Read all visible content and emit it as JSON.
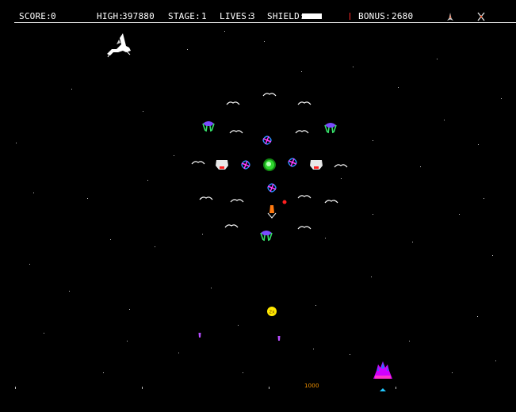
{
  "hud": {
    "score_label": "SCORE:",
    "score_value": "0",
    "high_label": "HIGH:",
    "high_value": "397880",
    "stage_label": "STAGE:",
    "stage_value": "1",
    "lives_label": "LIVES:",
    "lives_value": "3",
    "shield_label": "SHIELD:",
    "shield_level": 1.0,
    "bonus_label": "BONUS:",
    "bonus_value": "2680",
    "reserve_icons": [
      "reserve-ship-icon",
      "crossed-weapon-icon"
    ]
  },
  "popup": {
    "points": "1000"
  },
  "powerup": {
    "label": "2x"
  },
  "colors": {
    "background": "#000000",
    "hud_text": "#ffffff",
    "player_ship": "#d000ff",
    "enemy_core": "#33dd33",
    "bullet": "#ff2020",
    "popup": "#ff9a00"
  }
}
